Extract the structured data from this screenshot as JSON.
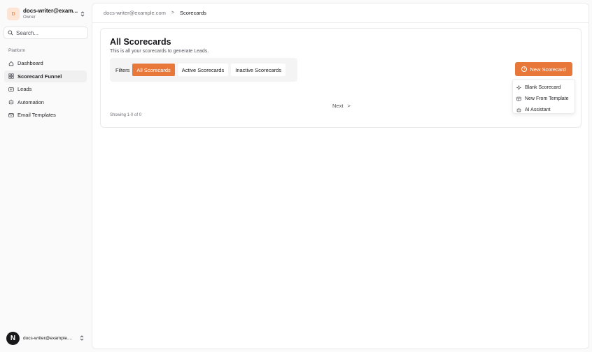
{
  "workspace": {
    "name": "docs-writer@exam...",
    "role": "Owner",
    "logo_letter": "D"
  },
  "search": {
    "placeholder": "Search..."
  },
  "sidebar": {
    "section_label": "Platform",
    "items": [
      {
        "label": "Dashboard",
        "icon": "house-icon"
      },
      {
        "label": "Scorecard Funnel",
        "icon": "grid-icon",
        "active": true
      },
      {
        "label": "Leads",
        "icon": "id-card-icon"
      },
      {
        "label": "Automation",
        "icon": "bot-icon"
      },
      {
        "label": "Email Templates",
        "icon": "mail-icon"
      }
    ]
  },
  "user": {
    "name": "docs-writer@example....",
    "avatar_letter": "N"
  },
  "breadcrumb": {
    "parent": "docs-writer@example.com",
    "current": "Scorecards"
  },
  "card": {
    "title": "All Scorecards",
    "subtitle": "This is all your scorecards to generate Leads.",
    "filters_label": "Filters",
    "filters": [
      "All Scorecards",
      "Active Scorecards",
      "Inactive Scorecards"
    ],
    "active_filter": 0,
    "next_label": "Next",
    "showing": "Showing 1-0 of 0"
  },
  "new_button": {
    "label": "New Scorecard"
  },
  "new_menu": {
    "items": [
      {
        "label": "Blank Scorecard",
        "icon": "sparkle-icon"
      },
      {
        "label": "New From Template",
        "icon": "template-icon"
      },
      {
        "label": "AI Assistant",
        "icon": "bot-icon"
      }
    ]
  },
  "colors": {
    "accent": "#e8773a",
    "accent_light": "#fde4d4",
    "dark": "#18181b"
  }
}
